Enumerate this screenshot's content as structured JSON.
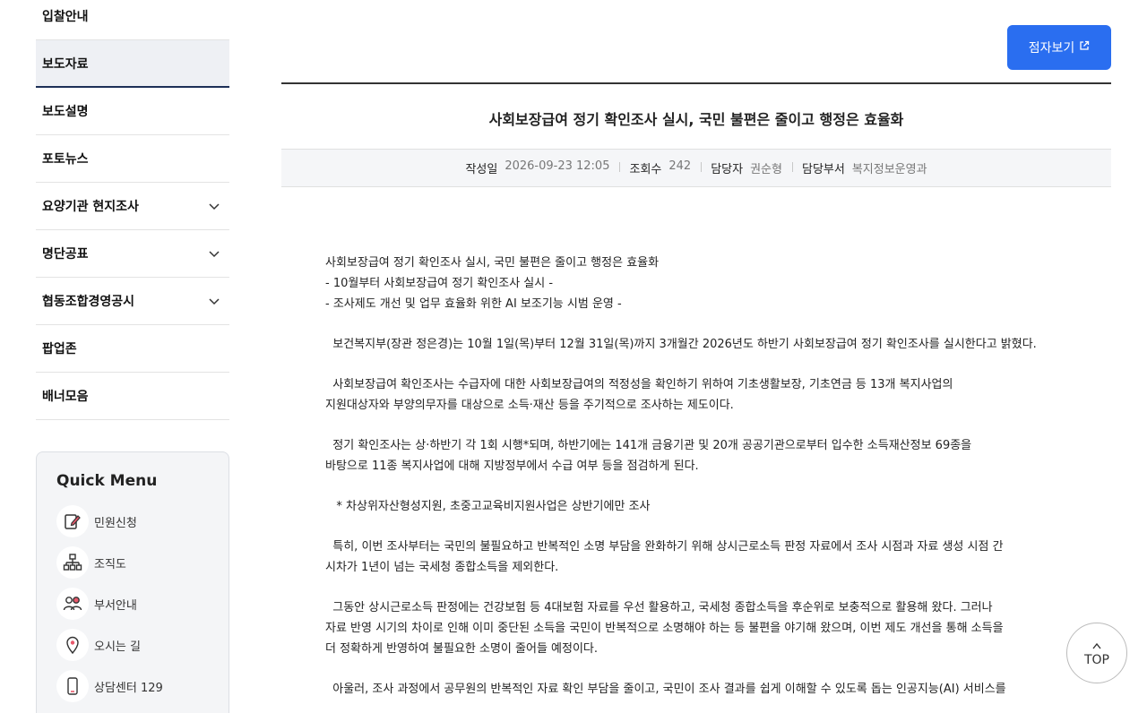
{
  "sidebar": {
    "items": [
      {
        "label": "입찰안내",
        "has_children": false
      },
      {
        "label": "보도자료",
        "has_children": false,
        "active": true
      },
      {
        "label": "보도설명",
        "has_children": false
      },
      {
        "label": "포토뉴스",
        "has_children": false
      },
      {
        "label": "요양기관 현지조사",
        "has_children": true
      },
      {
        "label": "명단공표",
        "has_children": true
      },
      {
        "label": "협동조합경영공시",
        "has_children": true
      },
      {
        "label": "팝업존",
        "has_children": false
      },
      {
        "label": "배너모음",
        "has_children": false
      }
    ]
  },
  "quick_menu": {
    "title": "Quick Menu",
    "items": [
      {
        "label": "민원신청",
        "icon": "form-edit-icon"
      },
      {
        "label": "조직도",
        "icon": "org-chart-icon"
      },
      {
        "label": "부서안내",
        "icon": "people-icon"
      },
      {
        "label": "오시는 길",
        "icon": "location-pin-icon"
      },
      {
        "label": "상담센터 129",
        "icon": "phone-icon"
      }
    ]
  },
  "toolbar": {
    "braille_label": "점자보기",
    "accent": "#2a6ef0"
  },
  "article": {
    "title": "사회보장급여 정기 확인조사 실시, 국민 불편은 줄이고 행정은 효율화",
    "meta": {
      "date_label": "작성일",
      "date_value": "2026-09-23 12:05",
      "views_label": "조회수",
      "views_value": "242",
      "manager_label": "담당자",
      "manager_value": "권순형",
      "dept_label": "담당부서",
      "dept_value": "복지정보운영과"
    },
    "body": {
      "head1": "사회보장급여 정기 확인조사 실시, 국민 불편은 줄이고 행정은 효율화",
      "head2": "- 10월부터 사회보장급여 정기 확인조사 실시 -",
      "head3": "- 조사제도 개선 및 업무 효율화 위한 AI 보조기능 시범 운영 -",
      "p1": "  보건복지부(장관 정은경)는 10월 1일(목)부터 12월 31일(목)까지 3개월간 2026년도 하반기 사회보장급여 정기 확인조사를 실시한다고 밝혔다.",
      "p2": "  사회보장급여 확인조사는 수급자에 대한 사회보장급여의 적정성을 확인하기 위하여 기초생활보장, 기초연금 등 13개 복지사업의\n지원대상자와 부양의무자를 대상으로 소득·재산 등을 주기적으로 조사하는 제도이다.",
      "p3": "  정기 확인조사는 상·하반기 각 1회 시행*되며, 하반기에는 141개 금융기관 및 20개 공공기관으로부터 입수한 소득재산정보 69종을\n바탕으로 11종 복지사업에 대해 지방정부에서 수급 여부 등을 점검하게 된다.",
      "p4": "   * 차상위자산형성지원, 초중고교육비지원사업은 상반기에만 조사",
      "p5": "  특히, 이번 조사부터는 국민의 불필요하고 반복적인 소명 부담을 완화하기 위해 상시근로소득 판정 자료에서 조사 시점과 자료 생성 시점 간\n시차가 1년이 넘는 국세청 종합소득을 제외한다.",
      "p6": "  그동안 상시근로소득 판정에는 건강보험 등 4대보험 자료를 우선 활용하고, 국세청 종합소득을 후순위로 보충적으로 활용해 왔다. 그러나\n자료 반영 시기의 차이로 인해 이미 중단된 소득을 국민이 반복적으로 소명해야 하는 등 불편을 야기해 왔으며, 이번 제도 개선을 통해 소득을\n더 정확하게 반영하여 불필요한 소명이 줄어들 예정이다.",
      "p7": "  아울러, 조사 과정에서 공무원의 반복적인 자료 확인 부담을 줄이고, 국민이 조사 결과를 쉽게 이해할 수 있도록 돕는 인공지능(AI) 서비스를"
    }
  },
  "top_button": {
    "arrow": "^",
    "label": "TOP"
  }
}
